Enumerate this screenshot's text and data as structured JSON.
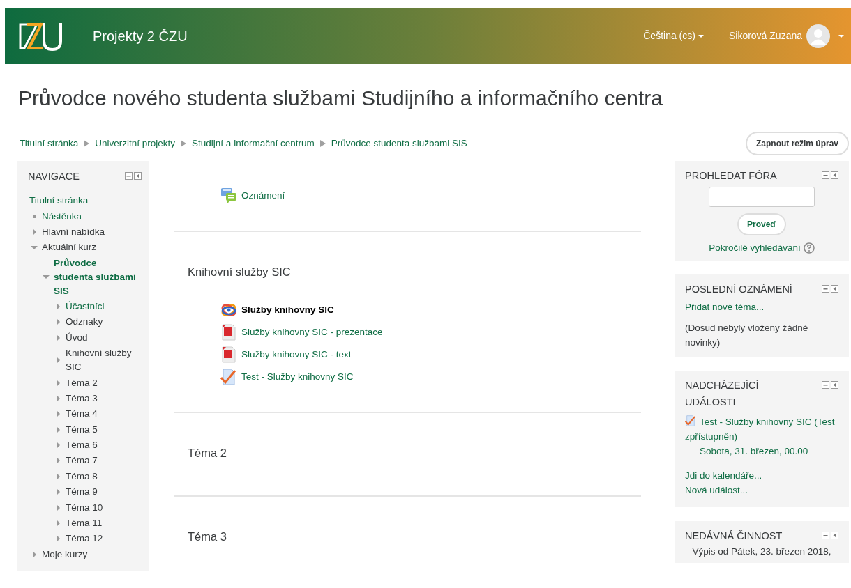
{
  "header": {
    "site_name": "Projekty 2 ČZU",
    "language": "Čeština (cs)",
    "user_name": "Sikorová Zuzana"
  },
  "page_title": "Průvodce nového studenta službami Studijního a informačního centra",
  "breadcrumb": [
    "Titulní stránka",
    "Univerzitní projekty",
    "Studijní a informační centrum",
    "Průvodce studenta službami SIS"
  ],
  "edit_button": "Zapnout režim úprav",
  "navigation": {
    "title": "NAVIGACE",
    "items": [
      {
        "label": "Titulní stránka",
        "kind": "plain",
        "link": true,
        "current": false,
        "children": [
          {
            "label": "Nástěnka",
            "kind": "leaf",
            "link": true,
            "current": false
          },
          {
            "label": "Hlavní nabídka",
            "kind": "branch",
            "expanded": false,
            "link": false,
            "current": false
          },
          {
            "label": "Aktuální kurz",
            "kind": "branch",
            "expanded": true,
            "link": false,
            "current": false,
            "children": [
              {
                "label": "Průvodce studenta službami SIS",
                "kind": "branch",
                "expanded": true,
                "link": true,
                "current": true,
                "children": [
                  {
                    "label": "Účastníci",
                    "kind": "branch",
                    "expanded": false,
                    "link": true,
                    "current": false
                  },
                  {
                    "label": "Odznaky",
                    "kind": "branch",
                    "expanded": false,
                    "link": false,
                    "current": false
                  },
                  {
                    "label": "Úvod",
                    "kind": "branch",
                    "expanded": false,
                    "link": false,
                    "current": false
                  },
                  {
                    "label": "Knihovní služby SIC",
                    "kind": "branch",
                    "expanded": false,
                    "link": false,
                    "current": false
                  },
                  {
                    "label": "Téma 2",
                    "kind": "branch",
                    "expanded": false,
                    "link": false,
                    "current": false
                  },
                  {
                    "label": "Téma 3",
                    "kind": "branch",
                    "expanded": false,
                    "link": false,
                    "current": false
                  },
                  {
                    "label": "Téma 4",
                    "kind": "branch",
                    "expanded": false,
                    "link": false,
                    "current": false
                  },
                  {
                    "label": "Téma 5",
                    "kind": "branch",
                    "expanded": false,
                    "link": false,
                    "current": false
                  },
                  {
                    "label": "Téma 6",
                    "kind": "branch",
                    "expanded": false,
                    "link": false,
                    "current": false
                  },
                  {
                    "label": "Téma 7",
                    "kind": "branch",
                    "expanded": false,
                    "link": false,
                    "current": false
                  },
                  {
                    "label": "Téma 8",
                    "kind": "branch",
                    "expanded": false,
                    "link": false,
                    "current": false
                  },
                  {
                    "label": "Téma 9",
                    "kind": "branch",
                    "expanded": false,
                    "link": false,
                    "current": false
                  },
                  {
                    "label": "Téma 10",
                    "kind": "branch",
                    "expanded": false,
                    "link": false,
                    "current": false
                  },
                  {
                    "label": "Téma 11",
                    "kind": "branch",
                    "expanded": false,
                    "link": false,
                    "current": false
                  },
                  {
                    "label": "Téma 12",
                    "kind": "branch",
                    "expanded": false,
                    "link": false,
                    "current": false
                  }
                ]
              }
            ]
          },
          {
            "label": "Moje kurzy",
            "kind": "branch",
            "expanded": false,
            "link": false,
            "current": false
          }
        ]
      }
    ]
  },
  "sections": [
    {
      "activities": [
        {
          "kind": "forum",
          "label": "Oznámení"
        }
      ]
    },
    {
      "title": "Knihovní služby SIC",
      "activities": [
        {
          "kind": "package",
          "label": "Služby knihovny SIC"
        },
        {
          "kind": "pdf",
          "label": "Služby knihovny SIC - prezentace"
        },
        {
          "kind": "pdf",
          "label": "Služby knihovny SIC - text"
        },
        {
          "kind": "quiz",
          "label": "Test - Služby knihovny SIC"
        }
      ]
    },
    {
      "title": "Téma 2"
    },
    {
      "title": "Téma 3"
    }
  ],
  "blocks": [
    {
      "kind": "search",
      "title": "PROHLEDAT FÓRA",
      "button": "Proveď",
      "link": "Pokročilé vyhledávání"
    },
    {
      "kind": "news",
      "title": "POSLEDNÍ OZNÁMENÍ",
      "link": "Přidat nové téma...",
      "text": "(Dosud nebyly vloženy žádné novinky)"
    },
    {
      "kind": "events",
      "title": "NADCHÁZEJÍCÍ UDÁLOSTI",
      "event": "Test - Služby knihovny SIC (Test zpřístupněn)",
      "date": "Sobota, 31. březen, 00.00",
      "links": [
        "Jdi do kalendáře...",
        "Nová událost..."
      ]
    },
    {
      "kind": "activity",
      "title": "NEDÁVNÁ ČINNOST",
      "text": "Výpis od Pátek, 23. březen 2018,"
    }
  ]
}
